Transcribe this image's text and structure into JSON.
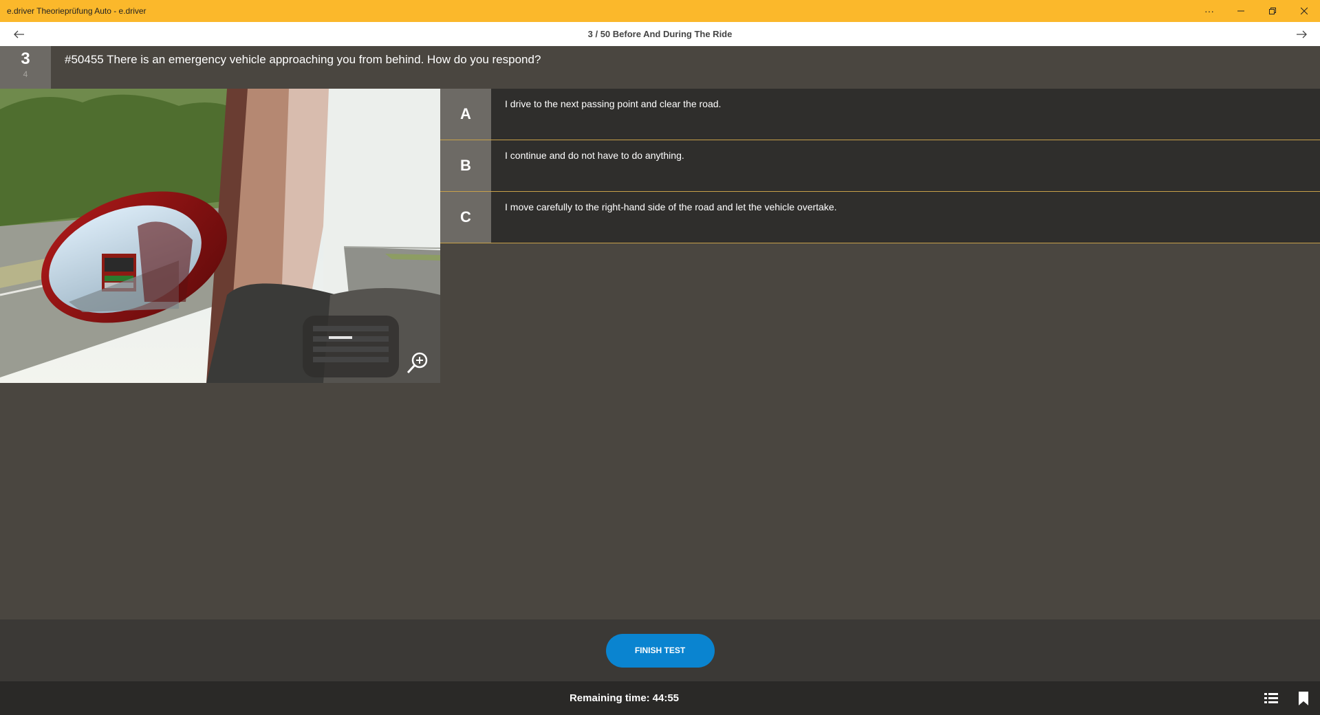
{
  "window": {
    "title": "e.driver Theorieprüfung Auto - e.driver",
    "controls": [
      "more-icon",
      "minimize-icon",
      "restore-icon",
      "close-icon"
    ]
  },
  "nav": {
    "title": "3 / 50 Before And During The Ride",
    "back_icon": "arrow-left-icon",
    "forward_icon": "arrow-right-icon"
  },
  "question": {
    "number": "3",
    "points": "4",
    "text": "#50455 There is an emergency vehicle approaching you from behind. How do you respond?"
  },
  "answers": [
    {
      "letter": "A",
      "text": "I drive to the next passing point and clear the road."
    },
    {
      "letter": "B",
      "text": "I continue and do not have to do anything."
    },
    {
      "letter": "C",
      "text": "I move carefully to the right-hand side of the road and let the vehicle overtake."
    }
  ],
  "footer": {
    "finish_label": "FINISH TEST",
    "remaining_label": "Remaining time:",
    "remaining_value": "44:55"
  },
  "colors": {
    "titlebar": "#fbb82b",
    "accent_button": "#0a84d0",
    "answer_divider": "#c9a24a",
    "background": "#4a4640"
  }
}
